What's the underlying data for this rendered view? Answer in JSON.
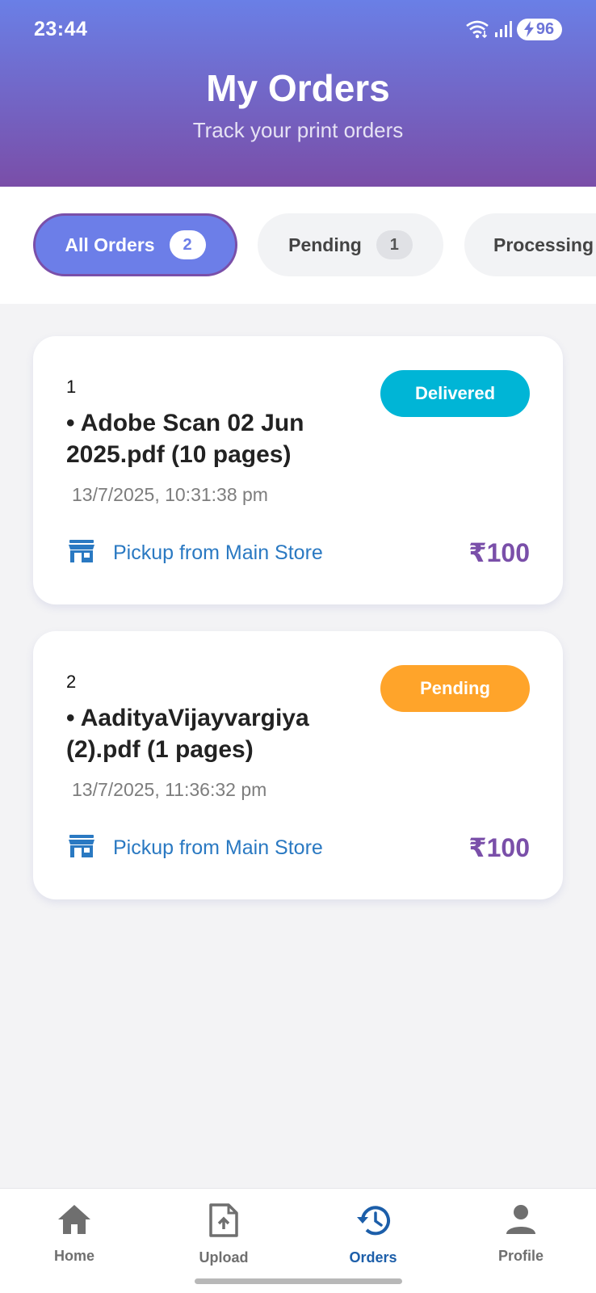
{
  "status_bar": {
    "time": "23:44",
    "battery": "96"
  },
  "header": {
    "title": "My Orders",
    "subtitle": "Track your print orders"
  },
  "tabs": [
    {
      "label": "All Orders",
      "count": "2",
      "active": true
    },
    {
      "label": "Pending",
      "count": "1",
      "active": false
    },
    {
      "label": "Processing",
      "active": false
    }
  ],
  "orders": [
    {
      "number": "1",
      "file": "• Adobe Scan 02 Jun 2025.pdf (10 pages)",
      "date": "13/7/2025, 10:31:38 pm",
      "status": "Delivered",
      "status_color": "#00b5d6",
      "pickup": "Pickup from Main Store",
      "price": "₹100"
    },
    {
      "number": "2",
      "file": "• AadityaVijayvargiya (2).pdf (1 pages)",
      "date": "13/7/2025, 11:36:32 pm",
      "status": "Pending",
      "status_color": "#ffa42a",
      "pickup": "Pickup from Main Store",
      "price": "₹100"
    }
  ],
  "bottom_nav": [
    {
      "label": "Home",
      "icon": "home-icon",
      "active": false
    },
    {
      "label": "Upload",
      "icon": "upload-file-icon",
      "active": false
    },
    {
      "label": "Orders",
      "icon": "history-icon",
      "active": true
    },
    {
      "label": "Profile",
      "icon": "person-icon",
      "active": false
    }
  ],
  "colors": {
    "header_gradient_top": "#6a7fe6",
    "header_gradient_bottom": "#7a4ea8",
    "accent_purple": "#7a4fa9",
    "link_blue": "#2a79c2",
    "nav_active": "#1c5ea9"
  }
}
